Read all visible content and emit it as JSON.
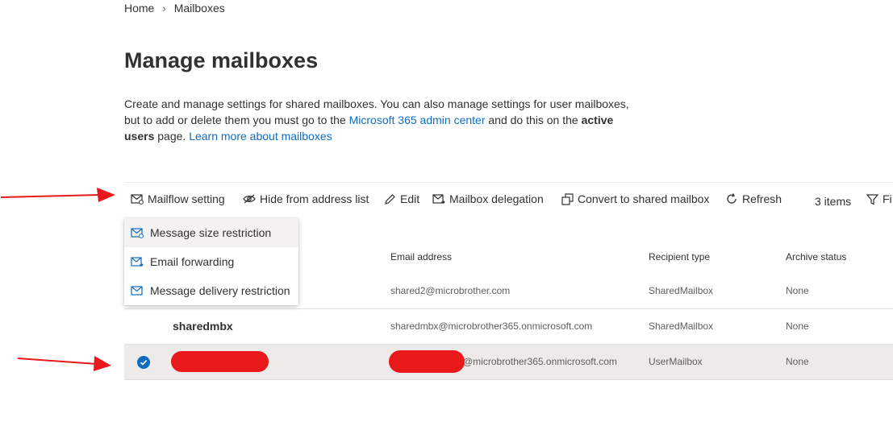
{
  "breadcrumb": {
    "home": "Home",
    "current": "Mailboxes"
  },
  "page": {
    "title": "Manage mailboxes",
    "desc_part1": "Create and manage settings for shared mailboxes. You can also manage settings for user mailboxes, but to add or delete them you must go to the ",
    "desc_link1": "Microsoft 365 admin center",
    "desc_part2": " and do this on the ",
    "desc_bold": "active users",
    "desc_part3": " page. ",
    "desc_link2": "Learn more about mailboxes"
  },
  "toolbar": {
    "mailflow": "Mailflow setting",
    "hide": "Hide from address list",
    "edit": "Edit",
    "delegation": "Mailbox delegation",
    "convert": "Convert to shared mailbox",
    "refresh": "Refresh",
    "count": "3 items",
    "filter": "Fi"
  },
  "menu": {
    "items": [
      {
        "label": "Message size restriction"
      },
      {
        "label": "Email forwarding"
      },
      {
        "label": "Message delivery restriction"
      }
    ]
  },
  "table": {
    "headers": {
      "email": "Email address",
      "recipient": "Recipient type",
      "archive": "Archive status"
    },
    "rows": [
      {
        "name": "",
        "email": "shared2@microbrother.com",
        "recipient": "SharedMailbox",
        "archive": "None"
      },
      {
        "name": "sharedmbx",
        "email": "sharedmbx@microbrother365.onmicrosoft.com",
        "recipient": "SharedMailbox",
        "archive": "None"
      },
      {
        "name": "",
        "email": "@microbrother365.onmicrosoft.com",
        "recipient": "UserMailbox",
        "archive": "None"
      }
    ]
  },
  "colors": {
    "accent": "#0f6cbd",
    "annotation": "#e8181b",
    "selected_row": "#edebe9"
  },
  "icons": [
    "chevron-right-icon",
    "mail-settings-icon",
    "hide-icon",
    "edit-icon",
    "mail-delegation-icon",
    "convert-icon",
    "refresh-icon",
    "filter-icon",
    "mail-icon",
    "check-circle-icon"
  ]
}
